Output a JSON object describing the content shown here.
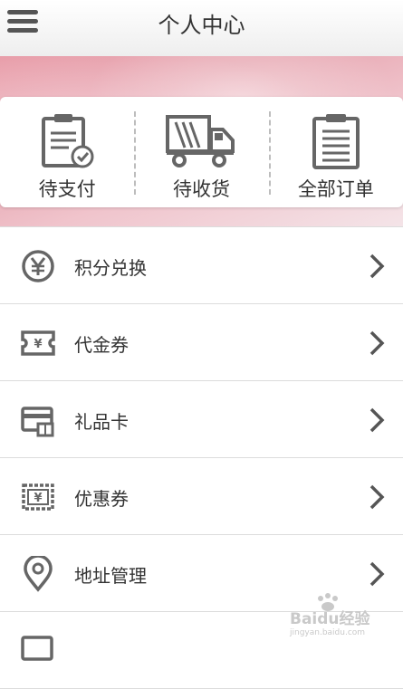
{
  "header": {
    "title": "个人中心",
    "menu_icon": "hamburger-icon"
  },
  "orders": [
    {
      "label": "待支付",
      "icon": "clipboard-check-icon"
    },
    {
      "label": "待收货",
      "icon": "truck-icon"
    },
    {
      "label": "全部订单",
      "icon": "clipboard-list-icon"
    }
  ],
  "menu": [
    {
      "label": "积分兑换",
      "icon": "yen-circle-icon"
    },
    {
      "label": "代金券",
      "icon": "voucher-ticket-icon"
    },
    {
      "label": "礼品卡",
      "icon": "gift-card-icon"
    },
    {
      "label": "优惠券",
      "icon": "coupon-icon"
    },
    {
      "label": "地址管理",
      "icon": "location-pin-icon"
    }
  ],
  "watermark": {
    "text": "Baidu经验",
    "subtext": "jingyan.baidu.com"
  },
  "colors": {
    "icon": "#666666",
    "text": "#333333",
    "banner": "#e79aa6"
  }
}
